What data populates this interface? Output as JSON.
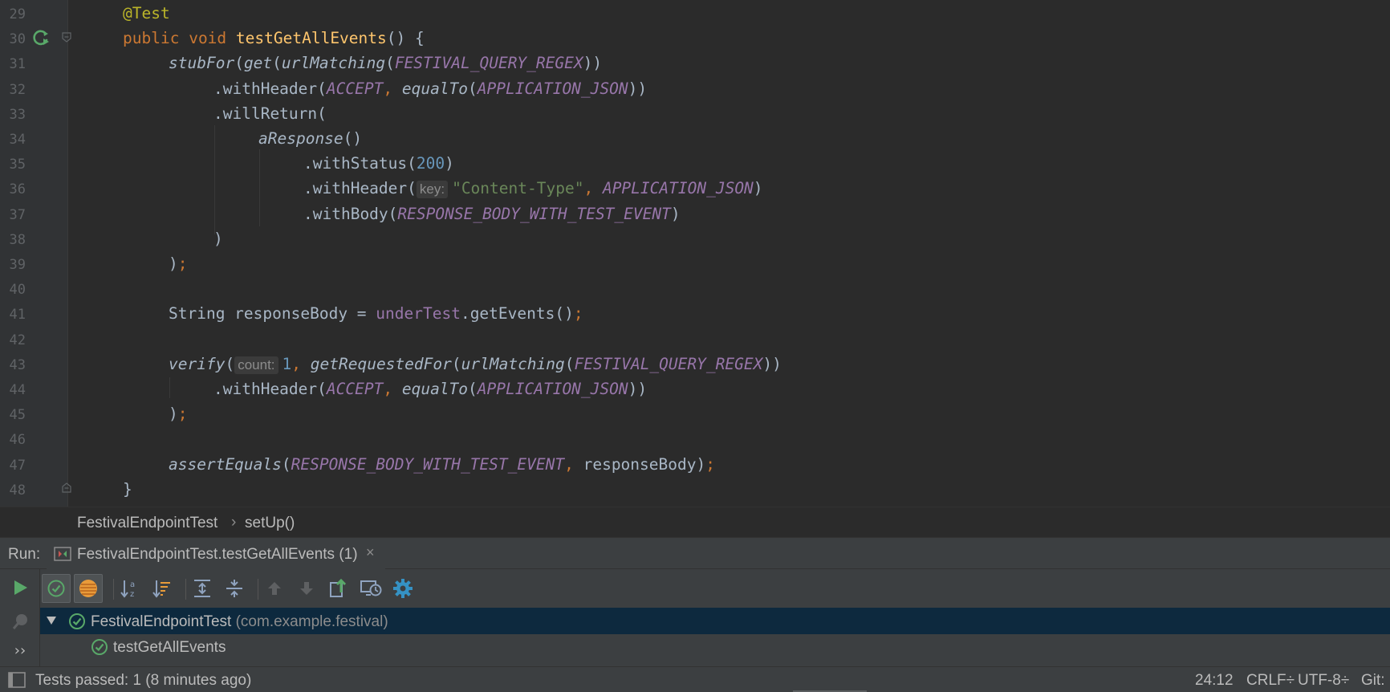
{
  "editor": {
    "line_numbers": [
      "29",
      "30",
      "31",
      "32",
      "33",
      "34",
      "35",
      "36",
      "37",
      "38",
      "39",
      "40",
      "41",
      "42",
      "43",
      "44",
      "45",
      "46",
      "47",
      "48"
    ],
    "lines": [
      [
        {
          "t": "@Test",
          "c": "ann"
        }
      ],
      [
        {
          "t": "public",
          "c": "kw"
        },
        {
          "t": " "
        },
        {
          "t": "void",
          "c": "kw"
        },
        {
          "t": " "
        },
        {
          "t": "testGetAllEvents",
          "c": "fn"
        },
        {
          "t": "() {"
        }
      ],
      [
        {
          "t": "stubFor",
          "c": "it"
        },
        {
          "t": "("
        },
        {
          "t": "get",
          "c": "it"
        },
        {
          "t": "("
        },
        {
          "t": "urlMatching",
          "c": "it"
        },
        {
          "t": "("
        },
        {
          "t": "FESTIVAL_QUERY_REGEX",
          "c": "cst"
        },
        {
          "t": "))"
        }
      ],
      [
        {
          "t": ".withHeader("
        },
        {
          "t": "ACCEPT",
          "c": "cst"
        },
        {
          "t": ",",
          "c": "semi"
        },
        {
          "t": " "
        },
        {
          "t": "equalTo",
          "c": "it"
        },
        {
          "t": "("
        },
        {
          "t": "APPLICATION_JSON",
          "c": "cst"
        },
        {
          "t": "))"
        }
      ],
      [
        {
          "t": ".willReturn("
        }
      ],
      [
        {
          "t": "aResponse",
          "c": "it"
        },
        {
          "t": "()"
        }
      ],
      [
        {
          "t": ".withStatus("
        },
        {
          "t": "200",
          "c": "num"
        },
        {
          "t": ")"
        }
      ],
      [
        {
          "t": ".withHeader("
        },
        {
          "t": "key:",
          "c": "hint"
        },
        {
          "t": "\"Content-Type\"",
          "c": "str"
        },
        {
          "t": ",",
          "c": "semi"
        },
        {
          "t": " "
        },
        {
          "t": "APPLICATION_JSON",
          "c": "cst"
        },
        {
          "t": ")"
        }
      ],
      [
        {
          "t": ".withBody("
        },
        {
          "t": "RESPONSE_BODY_WITH_TEST_EVENT",
          "c": "cst"
        },
        {
          "t": ")"
        }
      ],
      [
        {
          "t": ")"
        }
      ],
      [
        {
          "t": ")"
        },
        {
          "t": ";",
          "c": "semi"
        }
      ],
      [],
      [
        {
          "t": "String responseBody = "
        },
        {
          "t": "underTest",
          "c": "fld"
        },
        {
          "t": ".getEvents()"
        },
        {
          "t": ";",
          "c": "semi"
        }
      ],
      [],
      [
        {
          "t": "verify",
          "c": "it"
        },
        {
          "t": "("
        },
        {
          "t": "count:",
          "c": "hint"
        },
        {
          "t": "1",
          "c": "num"
        },
        {
          "t": ",",
          "c": "semi"
        },
        {
          "t": " "
        },
        {
          "t": "getRequestedFor",
          "c": "it"
        },
        {
          "t": "("
        },
        {
          "t": "urlMatching",
          "c": "it"
        },
        {
          "t": "("
        },
        {
          "t": "FESTIVAL_QUERY_REGEX",
          "c": "cst"
        },
        {
          "t": "))"
        }
      ],
      [
        {
          "t": ".withHeader("
        },
        {
          "t": "ACCEPT",
          "c": "cst"
        },
        {
          "t": ",",
          "c": "semi"
        },
        {
          "t": " "
        },
        {
          "t": "equalTo",
          "c": "it"
        },
        {
          "t": "("
        },
        {
          "t": "APPLICATION_JSON",
          "c": "cst"
        },
        {
          "t": "))"
        }
      ],
      [
        {
          "t": ")"
        },
        {
          "t": ";",
          "c": "semi"
        }
      ],
      [],
      [
        {
          "t": "assertEquals",
          "c": "it"
        },
        {
          "t": "("
        },
        {
          "t": "RESPONSE_BODY_WITH_TEST_EVENT",
          "c": "cst"
        },
        {
          "t": ",",
          "c": "semi"
        },
        {
          "t": " responseBody)"
        },
        {
          "t": ";",
          "c": "semi"
        }
      ],
      [
        {
          "t": "}"
        }
      ]
    ]
  },
  "breadcrumb": {
    "class_name": "FestivalEndpointTest",
    "separator": "›",
    "method_name": "setUp()"
  },
  "run_panel": {
    "label": "Run:",
    "tab_title": "FestivalEndpointTest.testGetAllEvents (1)",
    "tab_close": "×",
    "toolbar_icons": [
      "rerun-icon",
      "show-passed-icon",
      "show-ignored-icon",
      "sort-alpha-icon",
      "sort-duration-icon",
      "expand-all-icon",
      "collapse-all-icon",
      "previous-failed-icon",
      "next-failed-icon",
      "export-icon",
      "import-history-icon",
      "settings-gear-icon"
    ],
    "more_label": "››"
  },
  "test_tree": {
    "suite_name": "FestivalEndpointTest",
    "suite_package": "(com.example.festival)",
    "test_name": "testGetAllEvents"
  },
  "status_bar": {
    "message": "Tests passed: 1 (8 minutes ago)",
    "position": "24:12",
    "line_separator": "CRLF÷",
    "encoding": "UTF-8÷",
    "vcs": "Git:"
  },
  "colors": {
    "editor_bg": "#2b2b2b",
    "panel_bg": "#3c3f41",
    "keyword": "#cc7832",
    "method_decl": "#ffc66d",
    "constant": "#9876aa",
    "string": "#6a8759",
    "number": "#6897bb",
    "annotation": "#bbb529",
    "pass_green": "#59a869",
    "selection": "#0d293e"
  }
}
